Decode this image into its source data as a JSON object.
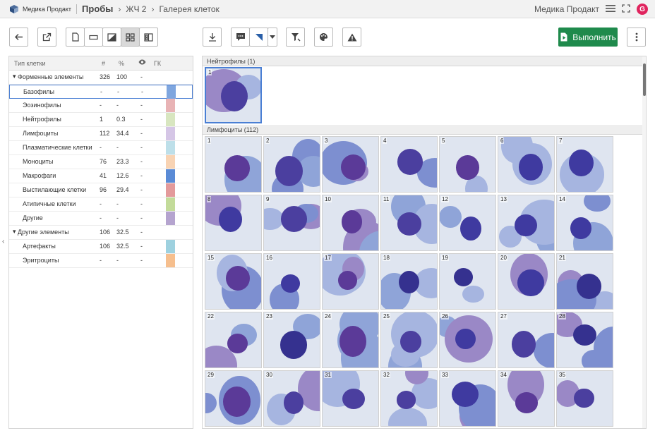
{
  "header": {
    "brand": "Медика Продакт",
    "breadcrumbs": [
      "Пробы",
      "ЖЧ 2",
      "Галерея клеток"
    ],
    "user": "Медика Продакт",
    "avatar_letter": "G"
  },
  "toolbar": {
    "run_label": "Выполнить"
  },
  "table": {
    "headers": {
      "type": "Тип клетки",
      "count": "#",
      "pct": "%",
      "hk": "ГК"
    },
    "rows": [
      {
        "label": "Форменные элементы",
        "count": "326",
        "pct": "100",
        "vis": "-",
        "group": true,
        "color": ""
      },
      {
        "label": "Базофилы",
        "count": "-",
        "pct": "-",
        "vis": "-",
        "group": false,
        "color": "#7fa6df"
      },
      {
        "label": "Эозинофилы",
        "count": "-",
        "pct": "-",
        "vis": "-",
        "group": false,
        "color": "#e8b3b5"
      },
      {
        "label": "Нейтрофилы",
        "count": "1",
        "pct": "0.3",
        "vis": "-",
        "group": false,
        "color": "#d8e6c0"
      },
      {
        "label": "Лимфоциты",
        "count": "112",
        "pct": "34.4",
        "vis": "-",
        "group": false,
        "color": "#d5c6e6"
      },
      {
        "label": "Плазматические клетки",
        "count": "-",
        "pct": "-",
        "vis": "-",
        "group": false,
        "color": "#bddfe9"
      },
      {
        "label": "Моноциты",
        "count": "76",
        "pct": "23.3",
        "vis": "-",
        "group": false,
        "color": "#f8d3b3"
      },
      {
        "label": "Макрофаги",
        "count": "41",
        "pct": "12.6",
        "vis": "-",
        "group": false,
        "color": "#5a8bd6"
      },
      {
        "label": "Выстилающие клетки",
        "count": "96",
        "pct": "29.4",
        "vis": "-",
        "group": false,
        "color": "#e39a9b"
      },
      {
        "label": "Атипичные клетки",
        "count": "-",
        "pct": "-",
        "vis": "-",
        "group": false,
        "color": "#c3db9a"
      },
      {
        "label": "Другие",
        "count": "-",
        "pct": "-",
        "vis": "-",
        "group": false,
        "color": "#b5a4cf"
      },
      {
        "label": "Другие элементы",
        "count": "106",
        "pct": "32.5",
        "vis": "-",
        "group": true,
        "color": ""
      },
      {
        "label": "Артефакты",
        "count": "106",
        "pct": "32.5",
        "vis": "-",
        "group": false,
        "color": "#9ed1df"
      },
      {
        "label": "Эритроциты",
        "count": "-",
        "pct": "-",
        "vis": "-",
        "group": false,
        "color": "#f6bf8e"
      }
    ]
  },
  "gallery": {
    "neutrophils_label": "Нейтрофилы (1)",
    "neutrophils": [
      "1"
    ],
    "lymphocytes_label": "Лимфоциты (112)",
    "lymphocytes": [
      "1",
      "2",
      "3",
      "4",
      "5",
      "6",
      "7",
      "8",
      "9",
      "10",
      "11",
      "12",
      "13",
      "14",
      "15",
      "16",
      "17",
      "18",
      "19",
      "20",
      "21",
      "22",
      "23",
      "24",
      "25",
      "26",
      "27",
      "28",
      "29",
      "30",
      "31",
      "32",
      "33",
      "34",
      "35"
    ]
  }
}
